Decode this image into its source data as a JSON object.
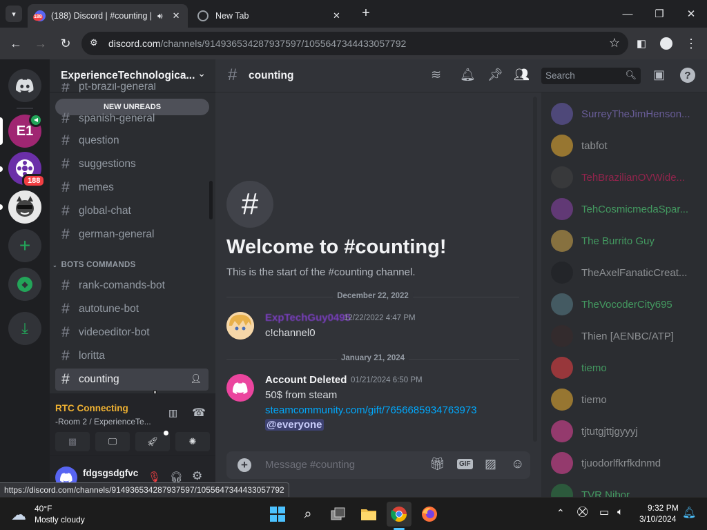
{
  "browser": {
    "tabs": [
      {
        "title": "(188) Discord | #counting | E",
        "badge": "188"
      },
      {
        "title": "New Tab"
      }
    ],
    "url_host": "discord.com",
    "url_path": "/channels/914936534287937597/1055647344433057792",
    "status_url": "https://discord.com/channels/914936534287937597/1055647344433057792"
  },
  "guilds": {
    "badge_count": "188",
    "server1_label": "E1"
  },
  "server": {
    "name": "ExperienceTechnologica...",
    "new_unreads": "NEW UNREADS",
    "partial_channel": "pt-brazil-general",
    "channels": [
      "spanish-general",
      "question",
      "suggestions",
      "memes",
      "global-chat",
      "german-general"
    ],
    "category": "BOTS COMMANDS",
    "bot_channels": [
      "rank-comands-bot",
      "autotune-bot",
      "videoeditor-bot",
      "loritta",
      "counting"
    ],
    "active_channel": "counting"
  },
  "voice": {
    "status": "RTC Connecting",
    "room": "-Room 2 / ExperienceTe..."
  },
  "user": {
    "name": "fdgsgsdgfvc"
  },
  "chat": {
    "channel": "counting",
    "search_placeholder": "Search",
    "welcome_title": "Welcome to #counting!",
    "welcome_sub": "This is the start of the #counting channel.",
    "dates": [
      "December 22, 2022",
      "January 21, 2024"
    ],
    "messages": [
      {
        "author": "ExpTechGuy0495",
        "time": "12/22/2022 4:47 PM",
        "text": "c!channel0"
      },
      {
        "author": "Account Deleted",
        "time": "01/21/2024 6:50 PM",
        "text": "50$ from steam",
        "link": "steamcommunity.com/gift/7656685934763973",
        "mention": "@everyone"
      }
    ],
    "input_placeholder": "Message #counting",
    "gif_label": "GIF"
  },
  "members": [
    {
      "name": "SurreyTheJimHenson...",
      "color": "#9b84ec"
    },
    {
      "name": "tabfot",
      "color": "#dbdee1"
    },
    {
      "name": "TehBrazilianOVWide...",
      "color": "#e91e63"
    },
    {
      "name": "TehCosmicmedaSpar...",
      "color": "#57f287"
    },
    {
      "name": "The Burrito Guy",
      "color": "#57f287"
    },
    {
      "name": "TheAxelFanaticCreat...",
      "color": "#dbdee1"
    },
    {
      "name": "TheVocoderCity695",
      "color": "#57f287"
    },
    {
      "name": "Thien [AENBC/ATP]",
      "color": "#dbdee1"
    },
    {
      "name": "tiemo",
      "color": "#57f287"
    },
    {
      "name": "tiemo",
      "color": "#dbdee1"
    },
    {
      "name": "tjtutgjttjgyyyj",
      "color": "#dbdee1"
    },
    {
      "name": "tjuodorlfkrfkdnmd",
      "color": "#dbdee1"
    },
    {
      "name": "TVR Nibor",
      "color": "#57f287"
    }
  ],
  "taskbar": {
    "temp": "40°F",
    "weather": "Mostly cloudy",
    "time": "9:32 PM",
    "date": "3/10/2024"
  },
  "colors": {
    "blurple": "#5865f2",
    "link": "#00a8fc",
    "green": "#23a559",
    "red_badge": "#f23f43",
    "voice_orange": "#f0b232"
  }
}
